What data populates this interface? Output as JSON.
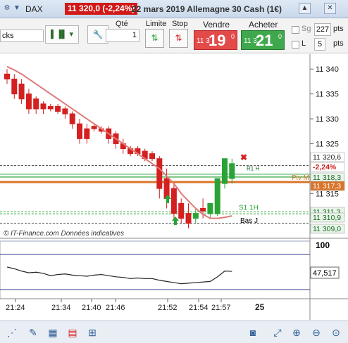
{
  "titlebar": {
    "instrument": "DAX",
    "price_change": "11 320,0 (-2,24%)",
    "description": "22 mars 2019 Allemagne 30 Cash (1€)",
    "icons": [
      "settings-icon",
      "arrow-down-icon"
    ],
    "window_controls": [
      "up-icon",
      "close-icon"
    ]
  },
  "toolbar": {
    "timeframe_value": "cks",
    "qty_label": "Qté",
    "qty_value": "1",
    "limit_label": "Limite",
    "stop_label": "Stop",
    "sell_label": "Vendre",
    "sell_prefix": "11 3",
    "sell_big": "19",
    "sell_sup": "0",
    "buy_label": "Acheter",
    "buy_prefix": "11 3",
    "buy_big": "21",
    "buy_sup": "0",
    "sg_label": "Sg",
    "sg_value": "227",
    "pts_label": "pts",
    "l_label": "L",
    "l_value": "5",
    "pts_label2": "pts",
    "sell_color": "#e34a4a",
    "buy_color": "#3fa84c"
  },
  "price_axis": {
    "ticks": [
      "11 340",
      "11 335",
      "11 330",
      "11 325",
      "11 315"
    ],
    "tags": [
      {
        "text": "11 320,6",
        "bg": "#ffffff",
        "fg": "#222222"
      },
      {
        "text": "-2,24%",
        "bg": "#ffffff",
        "fg": "#d11919"
      },
      {
        "text": "11 318,3",
        "bg": "#e8f4e8",
        "fg": "#1d6b26"
      },
      {
        "text": "11 317,3",
        "bg": "#d9742a",
        "fg": "#ffffff"
      },
      {
        "text": "11 311,3",
        "bg": "#e8f4e8",
        "fg": "#1d6b26"
      },
      {
        "text": "11 310,9",
        "bg": "#e8f4e8",
        "fg": "#1d6b26"
      },
      {
        "text": "11 309,0",
        "bg": "#e8f4e8",
        "fg": "#1d6b26"
      }
    ]
  },
  "chart_labels": {
    "pivot": "Piv M",
    "support": "S1 1H",
    "low": "Bas J",
    "r1": "R1 H",
    "credits": "© IT-Finance.com  Données indicatives"
  },
  "indicator": {
    "top_tick": "100",
    "last_value": "47,517"
  },
  "time_axis": {
    "ticks": [
      "21:24",
      "21:34",
      "21:40",
      "21:46",
      "21:52",
      "21:54",
      "21:57"
    ],
    "day": "25"
  },
  "colors": {
    "bear": "#d42020",
    "bull": "#2aa336",
    "ma": "#e07a7a",
    "pivot": "#d9742a",
    "support": "#2aa336"
  },
  "bottom_icons": [
    "share-icon",
    "pencil-icon",
    "grid-icon",
    "layers-icon",
    "tag-icon",
    "camera-icon",
    "expand-icon",
    "zoom-in-icon",
    "zoom-out-icon",
    "fit-icon"
  ],
  "chart_data": {
    "type": "candlestick",
    "title": "",
    "xlabel": "",
    "ylabel": "",
    "ylim": [
      11306,
      11343
    ],
    "candles": [
      {
        "o": 11339,
        "h": 11340,
        "c": 11338,
        "l": 11337
      },
      {
        "o": 11338,
        "h": 11339,
        "c": 11335,
        "l": 11334
      },
      {
        "o": 11337,
        "h": 11338,
        "c": 11334,
        "l": 11333
      },
      {
        "o": 11335,
        "h": 11336,
        "c": 11332,
        "l": 11331
      },
      {
        "o": 11334,
        "h": 11334.5,
        "c": 11332,
        "l": 11331
      },
      {
        "o": 11333,
        "h": 11333.5,
        "c": 11332,
        "l": 11331
      },
      {
        "o": 11332.5,
        "h": 11333,
        "c": 11332,
        "l": 11331.5
      },
      {
        "o": 11332.5,
        "h": 11333,
        "c": 11331.5,
        "l": 11331
      },
      {
        "o": 11332,
        "h": 11332.5,
        "c": 11331,
        "l": 11330
      },
      {
        "o": 11331,
        "h": 11331.5,
        "c": 11329,
        "l": 11328
      },
      {
        "o": 11329,
        "h": 11330,
        "c": 11326,
        "l": 11325
      },
      {
        "o": 11328,
        "h": 11329,
        "c": 11326,
        "l": 11325
      },
      {
        "o": 11328.5,
        "h": 11329,
        "c": 11328,
        "l": 11327.5
      },
      {
        "o": 11328,
        "h": 11328.5,
        "c": 11327.5,
        "l": 11327
      },
      {
        "o": 11328,
        "h": 11328.5,
        "c": 11326,
        "l": 11325
      },
      {
        "o": 11327,
        "h": 11327.5,
        "c": 11325,
        "l": 11324
      },
      {
        "o": 11325,
        "h": 11326,
        "c": 11324,
        "l": 11323
      },
      {
        "o": 11324,
        "h": 11324.5,
        "c": 11323,
        "l": 11322.5
      },
      {
        "o": 11324,
        "h": 11324.5,
        "c": 11323,
        "l": 11322.5
      },
      {
        "o": 11323.5,
        "h": 11324,
        "c": 11322,
        "l": 11321.5
      },
      {
        "o": 11323,
        "h": 11323.5,
        "c": 11322,
        "l": 11321.5
      },
      {
        "o": 11322,
        "h": 11322.5,
        "c": 11316,
        "l": 11314
      },
      {
        "o": 11318,
        "h": 11320,
        "c": 11314,
        "l": 11312
      },
      {
        "o": 11316,
        "h": 11317,
        "c": 11311,
        "l": 11310
      },
      {
        "o": 11313,
        "h": 11314,
        "c": 11310,
        "l": 11309
      },
      {
        "o": 11311,
        "h": 11313,
        "c": 11309,
        "l": 11308
      },
      {
        "o": 11310,
        "h": 11312,
        "c": 11311,
        "l": 11309
      },
      {
        "o": 11312,
        "h": 11314,
        "c": 11311.5,
        "l": 11310
      },
      {
        "o": 11311,
        "h": 11313,
        "c": 11313,
        "l": 11310
      },
      {
        "o": 11311,
        "h": 11318,
        "c": 11318,
        "l": 11310.5
      },
      {
        "o": 11317,
        "h": 11322,
        "c": 11322,
        "l": 11316
      },
      {
        "o": 11318,
        "h": 11322,
        "c": 11321,
        "l": 11317
      }
    ],
    "moving_average": [
      11340.5,
      11339.8,
      11339,
      11338,
      11337,
      11336,
      11335,
      11334,
      11333,
      11332,
      11331,
      11330,
      11329,
      11328,
      11327,
      11326,
      11325,
      11324,
      11323,
      11322,
      11321,
      11320,
      11318.5,
      11317,
      11315,
      11313.5,
      11312,
      11310.8,
      11310,
      11310,
      11310.2,
      11310.5
    ],
    "levels": {
      "pivot": 11317.3,
      "support_1h": 11311.3,
      "day_low": 11309.0,
      "r1": 11320.6,
      "green1": 11318.3,
      "green2": 11310.9
    },
    "oscillator": {
      "ylim": [
        0,
        100
      ],
      "values": [
        55,
        52,
        48,
        45,
        46,
        44,
        40,
        42,
        43,
        41,
        40,
        39,
        41,
        42,
        40,
        38,
        37,
        35,
        36,
        35,
        35,
        32,
        30,
        28,
        26,
        27,
        28,
        29,
        30,
        38,
        48,
        47.5
      ],
      "last": 47.517
    }
  }
}
